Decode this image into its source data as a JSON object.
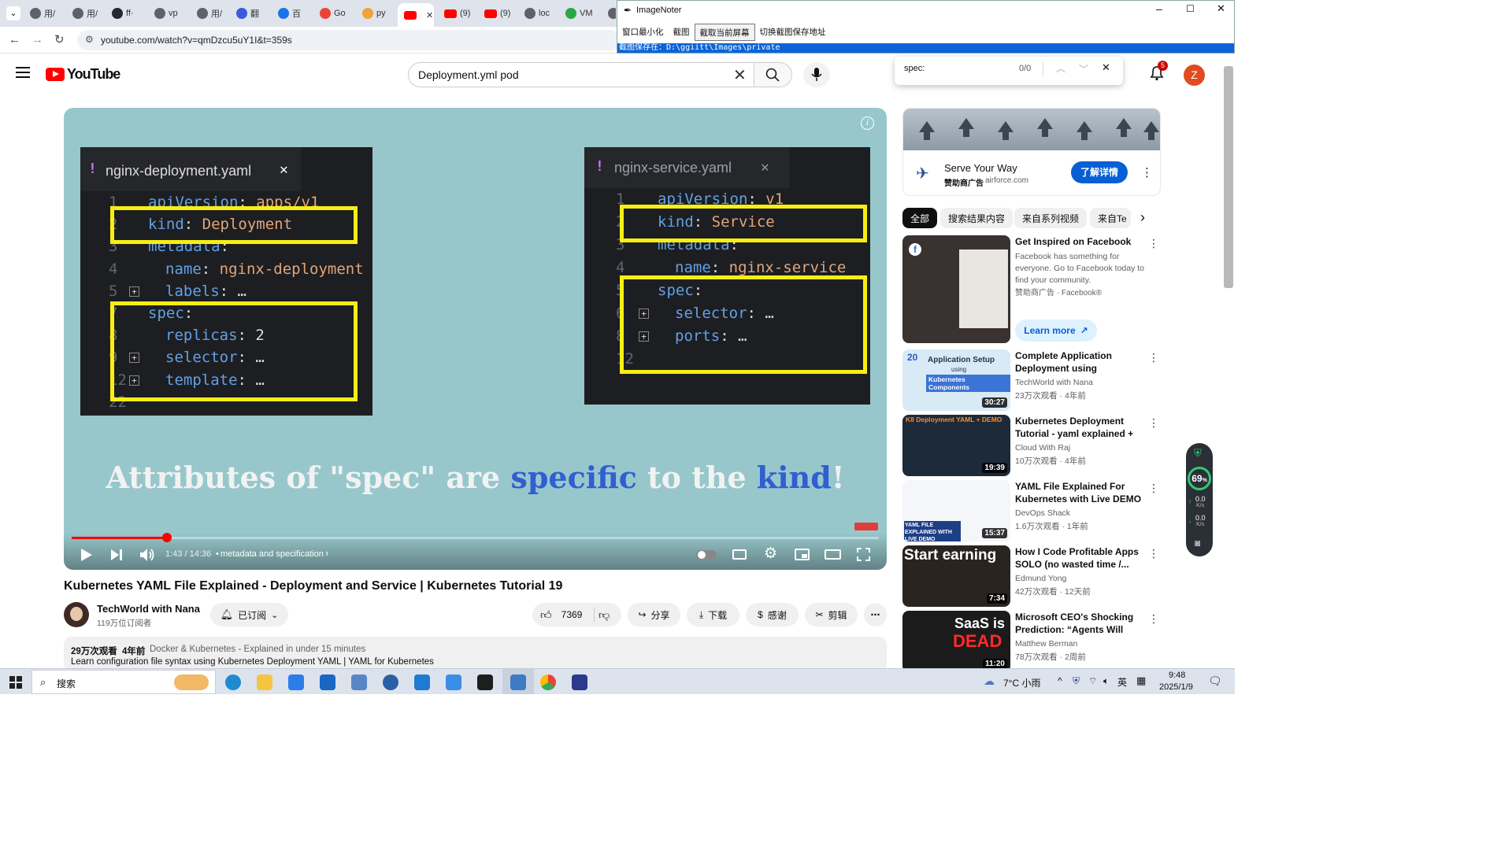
{
  "browser": {
    "tabs": [
      {
        "label": "用/",
        "color": "#5f6368"
      },
      {
        "label": "用/",
        "color": "#5f6368"
      },
      {
        "label": "ff·",
        "color": "#24292f"
      },
      {
        "label": "vp",
        "color": "#5f6368"
      },
      {
        "label": "用/",
        "color": "#5f6368"
      },
      {
        "label": "翻",
        "color": "#3b5bdb"
      },
      {
        "label": "百",
        "color": "#1a73e8"
      },
      {
        "label": "Go",
        "color": "#ea4335"
      },
      {
        "label": "py",
        "color": "#f2a13b"
      },
      {
        "label": "",
        "color": "#ff0000",
        "active": true
      },
      {
        "label": "(9)",
        "color": "#ff0000"
      },
      {
        "label": "(9)",
        "color": "#ff0000"
      },
      {
        "label": "loc",
        "color": "#5f6368"
      },
      {
        "label": "VM",
        "color": "#28a745"
      }
    ],
    "url": "youtube.com/watch?v=qmDzcu5uY1I&t=359s"
  },
  "image_noter": {
    "title": "ImageNoter",
    "menu": [
      "窗口最小化",
      "截图",
      "截取当前屏幕",
      "切换截图保存地址"
    ],
    "status": "截图保存在：D:\\ggiitt\\Images\\private"
  },
  "find_bar": {
    "query": "spec:",
    "count": "0/0"
  },
  "youtube": {
    "logo": "YouTube",
    "search_value": "Deployment.yml pod",
    "notification_count": "5",
    "avatar_letter": "Z"
  },
  "video": {
    "left_panel": {
      "filename": "nginx-deployment.yaml",
      "lines": [
        {
          "n": "1",
          "key": "apiVersion",
          "val": "apps/v1"
        },
        {
          "n": "2",
          "key": "kind",
          "val": "Deployment"
        },
        {
          "n": "3",
          "key": "metadata",
          "val": ""
        },
        {
          "n": "4",
          "key": "name",
          "val": "nginx-deployment"
        },
        {
          "n": "5",
          "key": "labels",
          "val": "…"
        },
        {
          "n": "7",
          "key": "spec",
          "val": ""
        },
        {
          "n": "8",
          "key": "replicas",
          "val": "2"
        },
        {
          "n": "9",
          "key": "selector",
          "val": "…"
        },
        {
          "n": "12",
          "key": "template",
          "val": "…"
        },
        {
          "n": "22",
          "key": "",
          "val": ""
        }
      ]
    },
    "right_panel": {
      "filename": "nginx-service.yaml",
      "lines": [
        {
          "n": "1",
          "key": "apiVersion",
          "val": "v1"
        },
        {
          "n": "2",
          "key": "kind",
          "val": "Service"
        },
        {
          "n": "3",
          "key": "metadata",
          "val": ""
        },
        {
          "n": "4",
          "key": "name",
          "val": "nginx-service"
        },
        {
          "n": "5",
          "key": "spec",
          "val": ""
        },
        {
          "n": "6",
          "key": "selector",
          "val": "…"
        },
        {
          "n": "8",
          "key": "ports",
          "val": "…"
        },
        {
          "n": "12",
          "key": "",
          "val": ""
        }
      ]
    },
    "subtitle_part1": "Attributes of \"spec\" are ",
    "subtitle_blue1": "specific",
    "subtitle_part2": " to the ",
    "subtitle_blue2": "kind",
    "subtitle_part3": "!",
    "time": "1:43 / 14:36",
    "chapter": "metadata and specification",
    "progress_fraction": 0.118
  },
  "details": {
    "title": "Kubernetes YAML File Explained - Deployment and Service | Kubernetes Tutorial 19",
    "channel": "TechWorld with Nana",
    "subscribers": "119万位订阅者",
    "subscribed_label": "已订阅",
    "likes": "7369",
    "share": "分享",
    "download": "下载",
    "thanks": "感谢",
    "clip": "剪辑",
    "views": "29万次观看",
    "age": "4年前",
    "playlist": "Docker & Kubernetes - Explained in under 15 minutes",
    "description": "Learn configuration file syntax using Kubernetes Deployment YAML | YAML for Kubernetes"
  },
  "ad": {
    "title": "Serve Your Way",
    "sponsor": "赞助商广告",
    "domain": "airforce.com",
    "cta": "了解详情"
  },
  "chips": [
    "全部",
    "搜索结果内容",
    "来自系列视频",
    "来自Te"
  ],
  "recommendations": [
    {
      "title": "Get Inspired on Facebook",
      "desc": "Facebook has something for everyone. Go to Facebook today to find your community.",
      "meta": "赞助商广告 · Facebook®",
      "cta": "Learn more",
      "thumb_color": "#3a3230"
    },
    {
      "title": "Complete Application Deployment using Kubernetes...",
      "channel": "TechWorld with Nana",
      "meta": "23万次观看 · 4年前",
      "duration": "30:27",
      "thumb_color": "#d8eaf5"
    },
    {
      "title": "Kubernetes Deployment Tutorial - yaml explained + Demo",
      "channel": "Cloud With Raj",
      "meta": "10万次观看 · 4年前",
      "duration": "19:39",
      "thumb_color": "#1c2a3a"
    },
    {
      "title": "YAML File Explained For Kubernetes with Live DEMO🔥...",
      "channel": "DevOps Shack",
      "meta": "1.6万次观看 · 1年前",
      "duration": "15:37",
      "thumb_color": "#f4f6fa"
    },
    {
      "title": "How I Code Profitable Apps SOLO (no wasted time /...",
      "channel": "Edmund Yong",
      "meta": "42万次观看 · 12天前",
      "duration": "7:34",
      "thumb_color": "#2a2420"
    },
    {
      "title": "Microsoft CEO's Shocking Prediction: “Agents Will Repla...",
      "channel": "Matthew Berman",
      "meta": "78万次观看 · 2周前",
      "duration": "11:20",
      "thumb_color": "#1b1b1b"
    }
  ],
  "rec_thumb_text": {
    "r1_line1": "Application Setup",
    "r1_line2": "using",
    "r1_line3": "Kubernetes Components",
    "r1_num": "20",
    "r2_banner": "K8 Deployment YAML + DEMO",
    "r3_banner": "YAML FILE EXPLAINED WITH LIVE DEMO",
    "r4_banner": "Start earning",
    "r5_line1": "SaaS is",
    "r5_line2": "DEAD"
  },
  "widget": {
    "percent": "69",
    "up": "0.0",
    "down": "0.0",
    "unit": "K/s"
  },
  "taskbar": {
    "search": "搜索",
    "weather": "7°C 小雨",
    "ime": "英",
    "time": "9:48",
    "date": "2025/1/9"
  }
}
